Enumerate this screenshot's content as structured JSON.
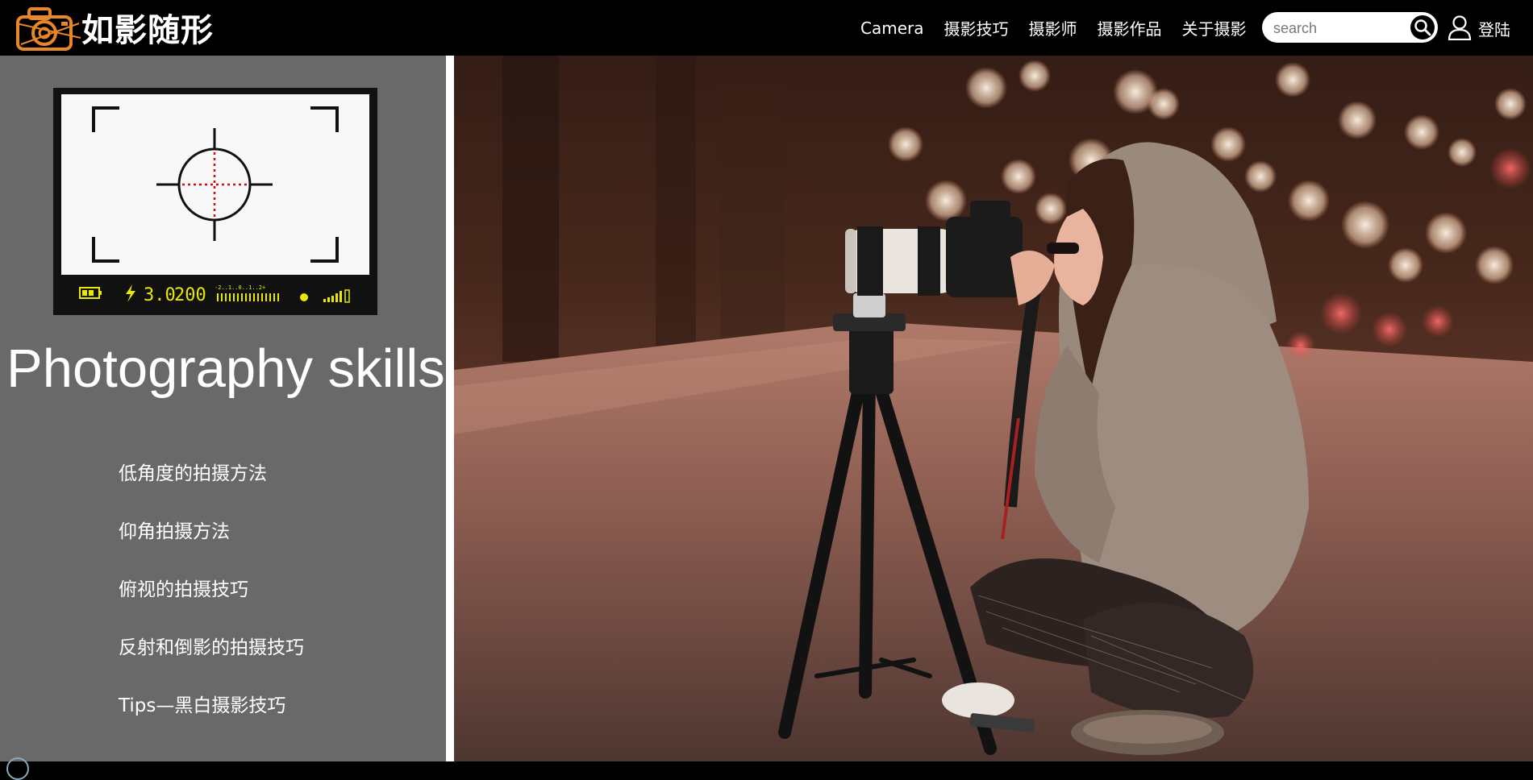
{
  "header": {
    "brand": "如影随形",
    "nav": [
      "Camera",
      "摄影技巧",
      "摄影师",
      "摄影作品",
      "关于摄影"
    ],
    "search_placeholder": "search",
    "login": "登陆"
  },
  "sidebar": {
    "viewfinder_readout": {
      "value1": "3.0",
      "value2": "200",
      "scale": "-2..1..0..1..2+"
    },
    "title": "Photography skills",
    "items": [
      "低角度的拍摄方法",
      "仰角拍摄方法",
      "俯视的拍摄技巧",
      "反射和倒影的拍摄技巧",
      "Tips—黑白摄影技巧"
    ]
  },
  "colors": {
    "header_bg": "#000000",
    "sidebar_bg": "#696969",
    "lcd_text": "#e8e800",
    "crosshair_red": "#d01010"
  }
}
